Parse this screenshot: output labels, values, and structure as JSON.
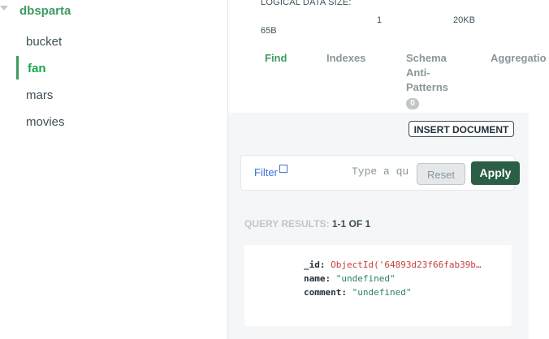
{
  "sidebar": {
    "database": "dbsparta",
    "collections": [
      "bucket",
      "fan",
      "mars",
      "movies"
    ],
    "active_collection": "fan"
  },
  "stats": {
    "label": "LOGICAL DATA SIZE:",
    "value1": "1",
    "value2": "20KB",
    "value3": "65B"
  },
  "tabs": {
    "find": "Find",
    "indexes": "Indexes",
    "schema_line1": "Schema",
    "schema_line2": "Anti-",
    "schema_line3": "Patterns",
    "schema_badge": "0",
    "aggregations": "Aggregatio"
  },
  "toolbar": {
    "insert_document": "INSERT DOCUMENT"
  },
  "filter": {
    "label": "Filter",
    "placeholder": "Type a qu",
    "reset": "Reset",
    "apply": "Apply"
  },
  "results": {
    "label": "QUERY RESULTS:",
    "count": "1-1 OF 1"
  },
  "document": {
    "id_key": "_id:",
    "id_value": "ObjectId('64893d23f66fab39b…",
    "name_key": "name:",
    "name_value": "\"undefined\"",
    "comment_key": "comment:",
    "comment_value": "\"undefined\""
  },
  "colors": {
    "accent_green": "#3d9b62",
    "apply_button": "#2b5e44",
    "filter_link": "#3f6fd8",
    "objectid": "#c3413b",
    "string_value": "#2a7f62"
  }
}
